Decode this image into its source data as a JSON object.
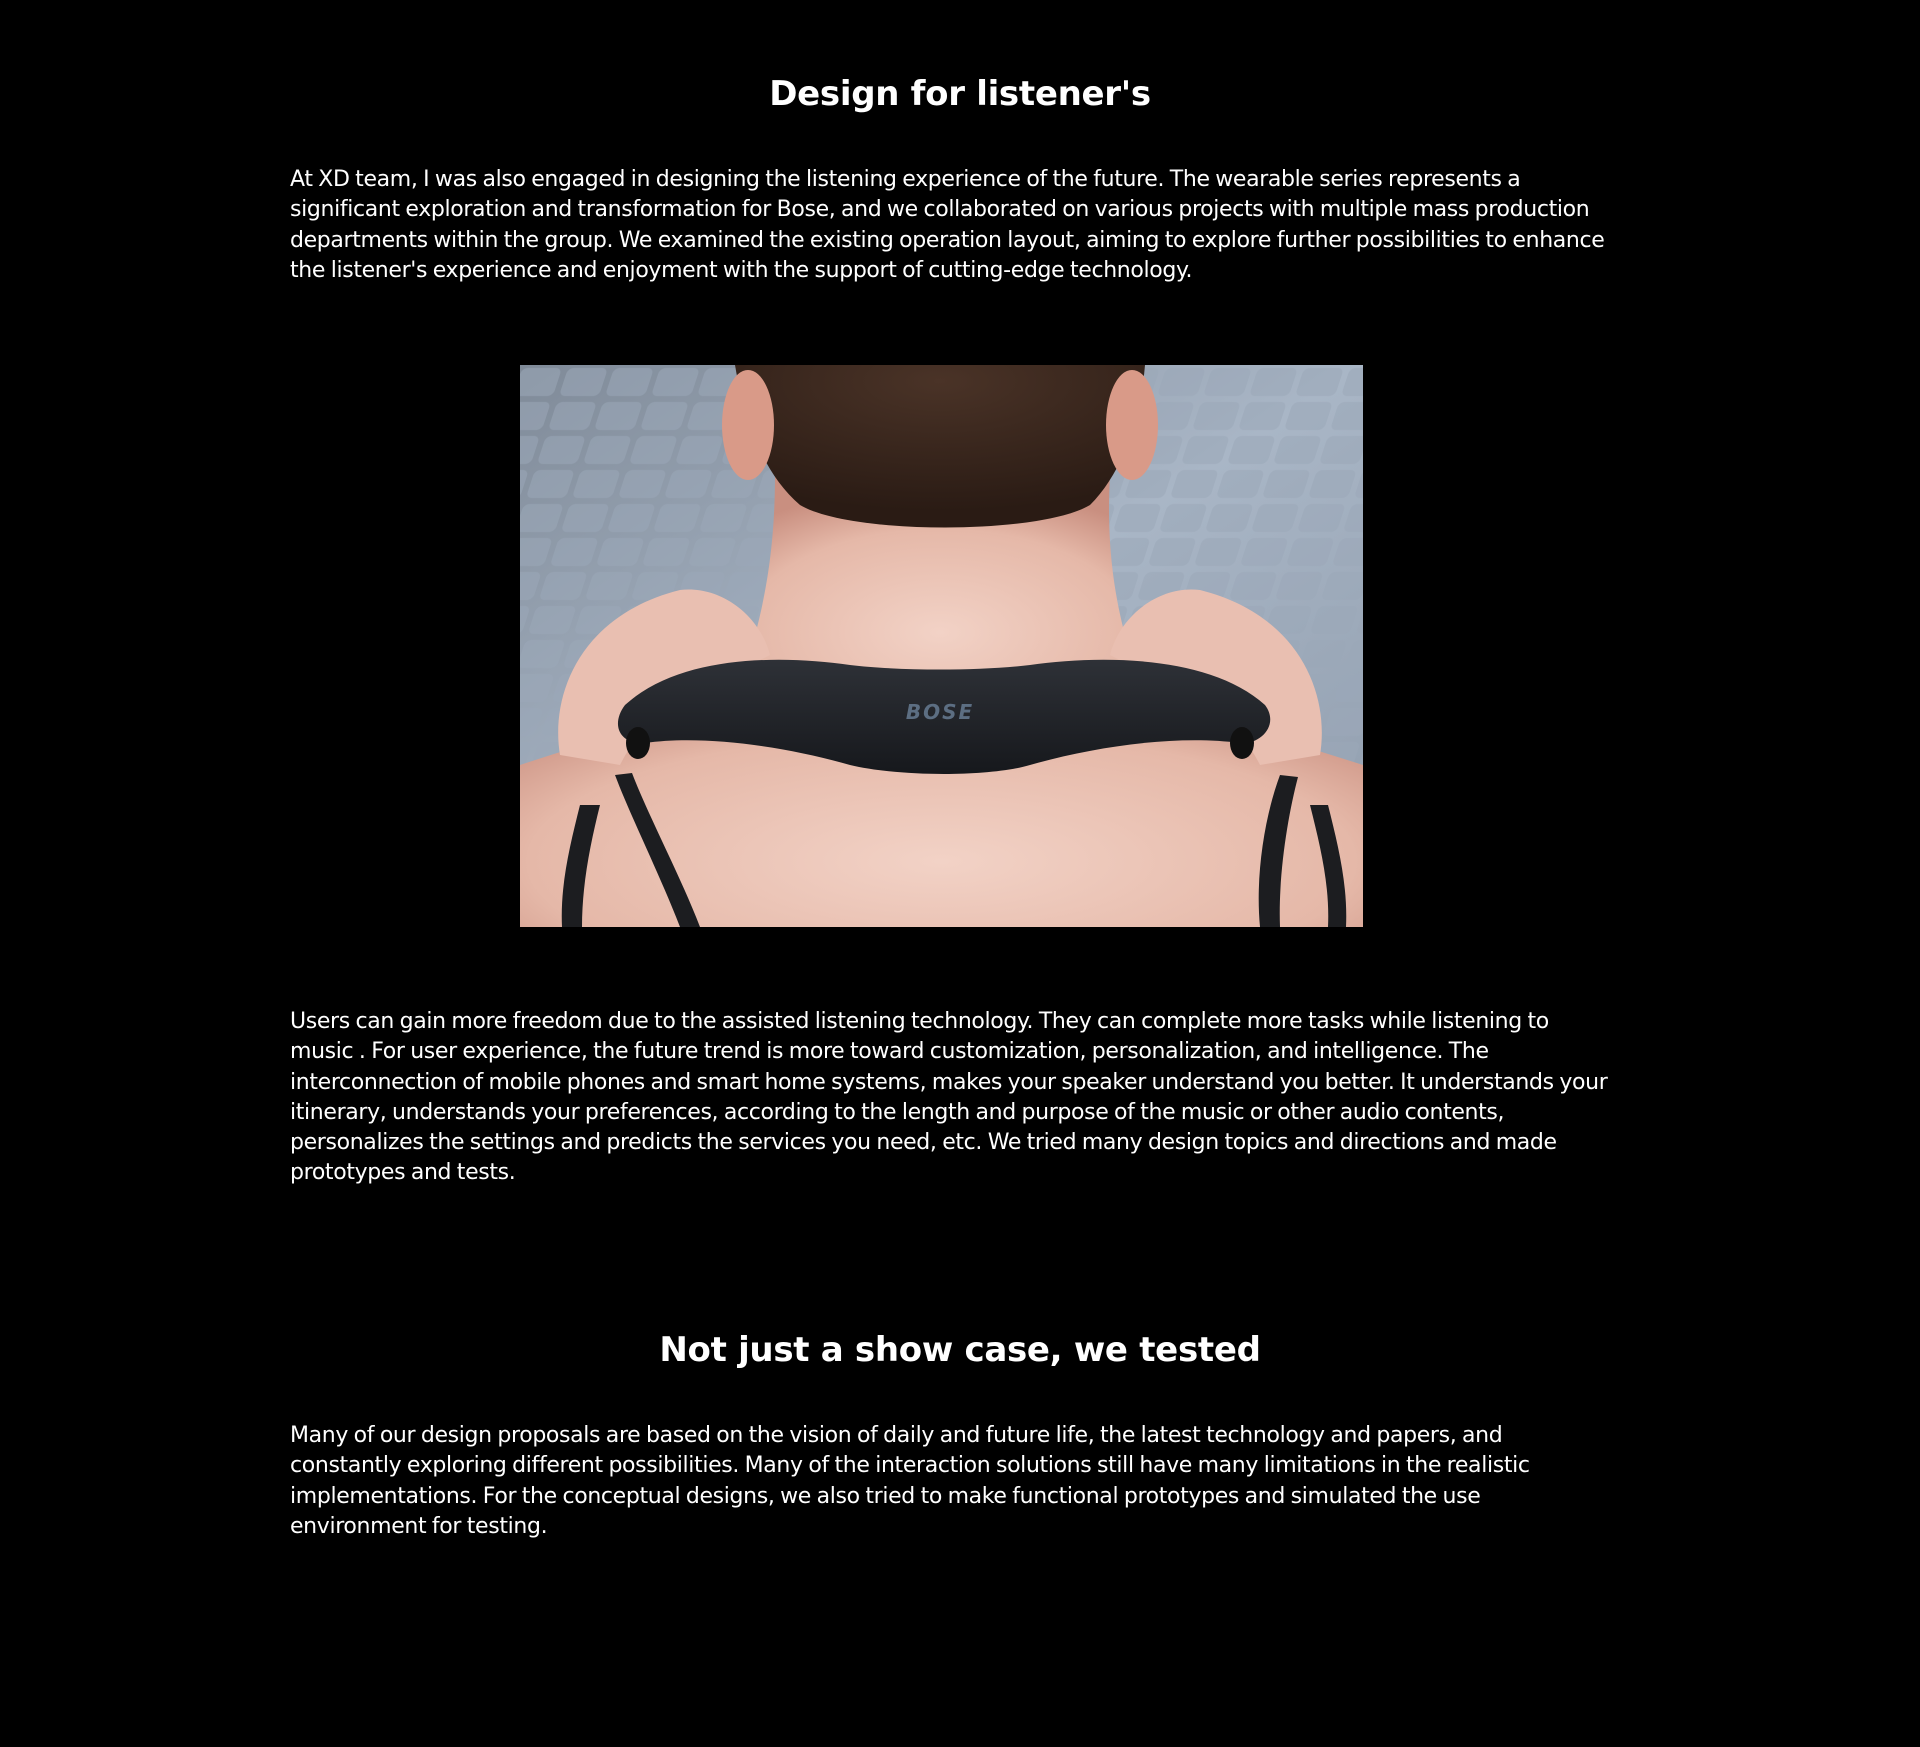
{
  "section1": {
    "heading": "Design for listener's",
    "paragraph": "At XD team, I was also engaged in designing the listening experience of the future. The wearable series represents a significant exploration and transformation for Bose, and we collaborated on various projects with multiple mass production departments within the group. We examined the existing operation layout, aiming to explore further possibilities to enhance the listener's experience and enjoyment with the support of cutting-edge technology."
  },
  "photo": {
    "brand_text": "BOSE"
  },
  "section2": {
    "paragraph": "Users can gain more freedom due to the assisted listening technology. They can complete more tasks while listening to music . For user experience, the future trend is more toward customization, personalization, and intelligence. The interconnection of mobile phones and smart home systems, makes your speaker understand you better. It understands your itinerary, understands your preferences, according to the length and purpose of the music or other audio contents, personalizes the settings and predicts the services you need, etc. We tried many design topics and directions and made prototypes and tests."
  },
  "section3": {
    "heading": "Not just a show case, we tested",
    "paragraph": "Many of our design proposals are based on the vision of daily and future life, the latest technology and papers, and constantly exploring different possibilities. Many of the interaction  solutions still have many limitations in the realistic implementations. For the conceptual designs, we also tried to make functional prototypes and simulated the use environment for testing."
  },
  "colors": {
    "background": "#000000",
    "text": "#ffffff"
  }
}
